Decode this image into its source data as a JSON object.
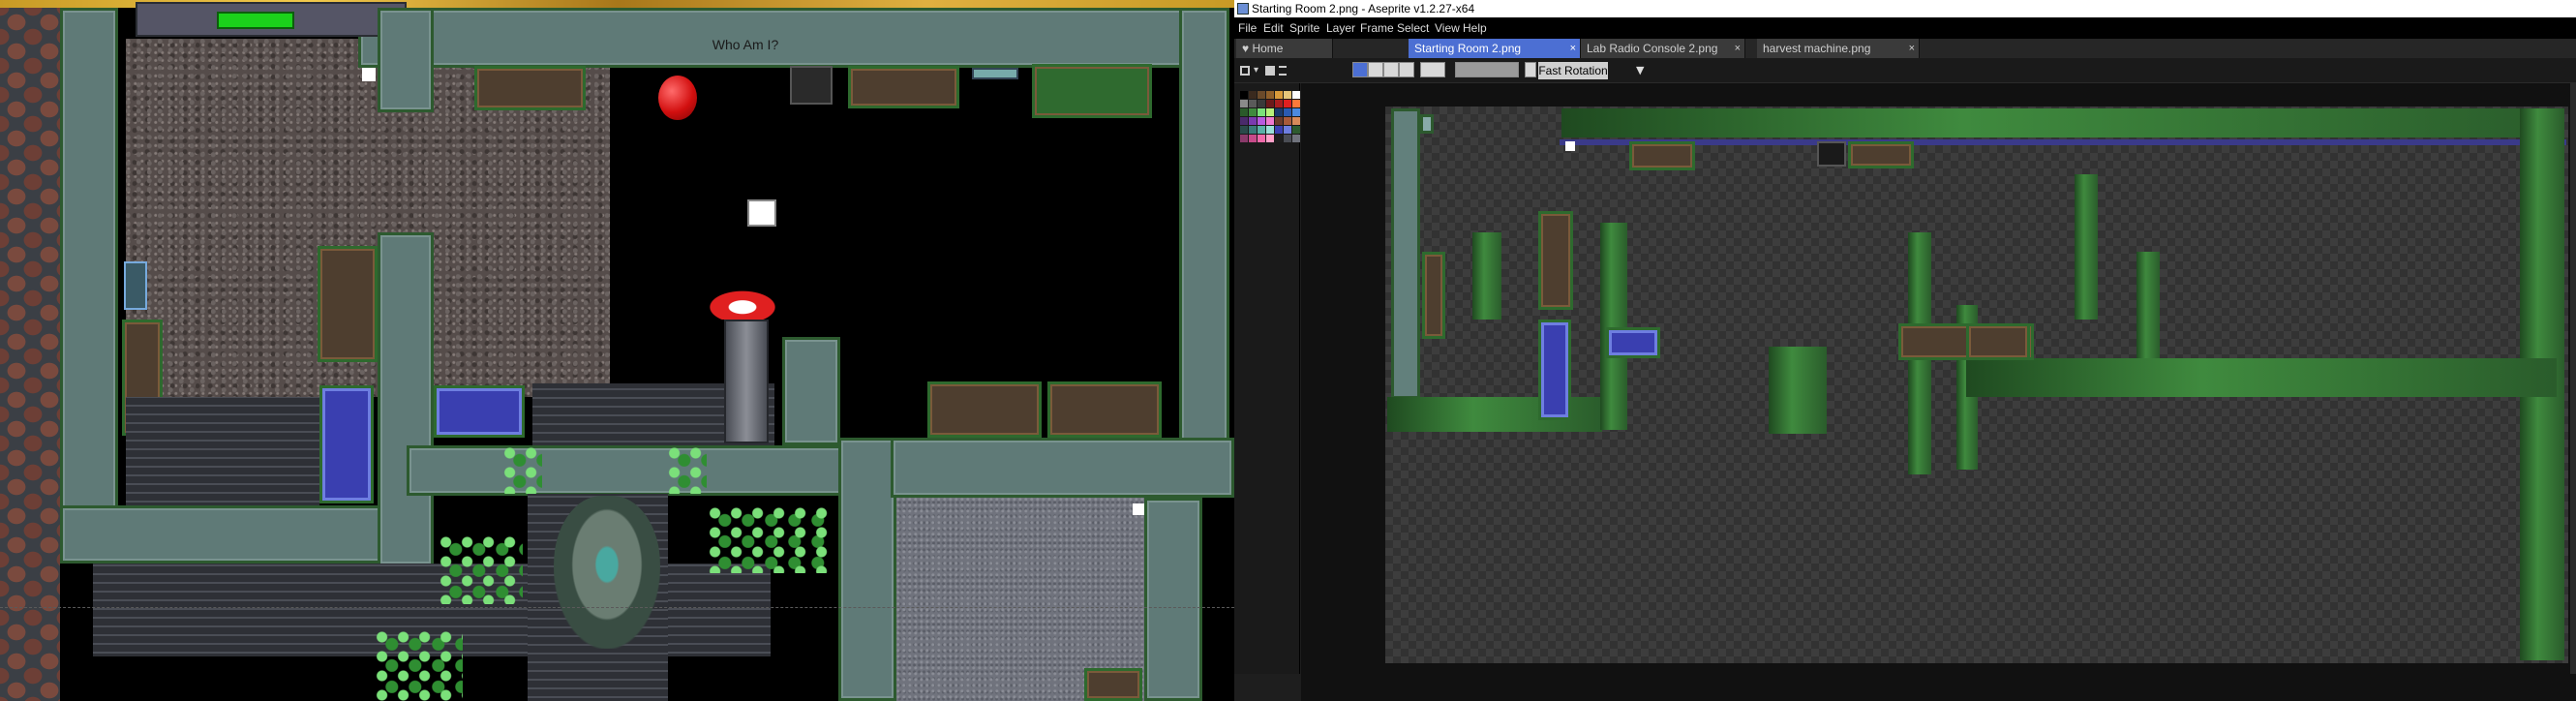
{
  "game": {
    "room_title": "Who Am I?"
  },
  "editor": {
    "window_title": "Starting Room 2.png - Aseprite v1.2.27-x64",
    "menu": [
      "File",
      "Edit",
      "Sprite",
      "Layer",
      "Frame",
      "Select",
      "View",
      "Help"
    ],
    "tabs": [
      {
        "label": "Home",
        "active": false,
        "closable": false
      },
      {
        "label": "Starting Room 2.png",
        "active": true,
        "closable": true
      },
      {
        "label": "Lab Radio Console 2.png",
        "active": false,
        "closable": true
      },
      {
        "label": "harvest machine.png",
        "active": false,
        "closable": true
      }
    ],
    "tab_close_glyph": "×",
    "home_icon": "heart-icon",
    "toolbar": {
      "rotation_mode": "Fast Rotation"
    },
    "palette_colors": [
      "#000000",
      "#3a2a1e",
      "#6b4a2a",
      "#8f5f2a",
      "#d99a3a",
      "#e6c67a",
      "#ffffff",
      "#c6c6c6",
      "#8a8a8a",
      "#5a5a5a",
      "#3a3a3a",
      "#6b1a1a",
      "#a81e1e",
      "#e02020",
      "#ff7a3a",
      "#f2d24a",
      "#2a5a2a",
      "#3f8a3e",
      "#7be07a",
      "#b8f07a",
      "#1a3a6b",
      "#2a5ab0",
      "#4c8ae0",
      "#7ac8f0",
      "#4a2a6b",
      "#7a3ab0",
      "#b85ae0",
      "#f07ad0",
      "#6b3a2a",
      "#a85a3a",
      "#d88a5a",
      "#f0c0a0",
      "#2a4a4a",
      "#3a7a7a",
      "#5ab0a8",
      "#9ae0d8",
      "#3a3fb0",
      "#6e7ee0",
      "#2d5a2f",
      "#62807c",
      "#8a3a6a",
      "#c84a8a",
      "#f06aaa",
      "#ffa0c8",
      "#1e1e1e",
      "#4a4d55",
      "#70737d",
      "#a0a3ad"
    ]
  }
}
